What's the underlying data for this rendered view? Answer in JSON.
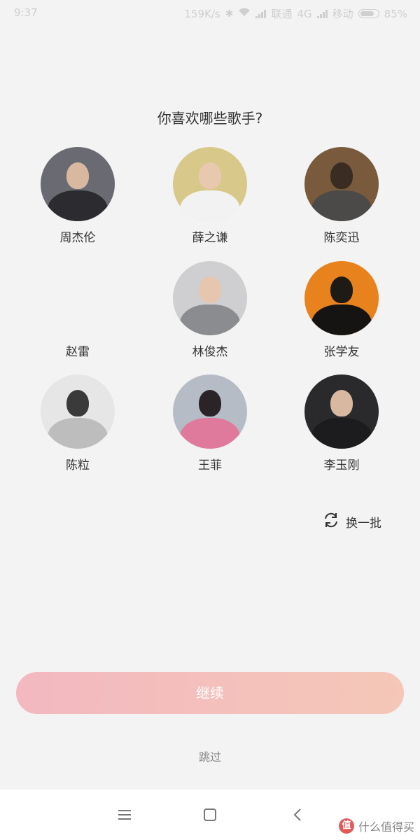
{
  "status_bar": {
    "time": "9:37",
    "speed": "159K/s",
    "carrier1": "联通",
    "net1": "4G",
    "carrier2": "移动",
    "battery": "85%"
  },
  "question": "你喜欢哪些歌手?",
  "singers": [
    {
      "name": "周杰伦",
      "colors": {
        "bg": "#6a6a72",
        "head": "#d9b8a0",
        "body": "#2c2c30"
      }
    },
    {
      "name": "薛之谦",
      "colors": {
        "bg": "#d8c88a",
        "head": "#e8c9b0",
        "body": "#f2f2f2"
      }
    },
    {
      "name": "陈奕迅",
      "colors": {
        "bg": "#7a5a3c",
        "head": "#3a2c22",
        "body": "#4c4a48"
      }
    },
    {
      "name": "赵雷",
      "colors": {
        "bg": "#f3f3f3",
        "head": "#f3f3f3",
        "body": "#f3f3f3"
      }
    },
    {
      "name": "林俊杰",
      "colors": {
        "bg": "#cfcfd1",
        "head": "#e6c6ae",
        "body": "#8a8c90"
      }
    },
    {
      "name": "张学友",
      "colors": {
        "bg": "#e8821c",
        "head": "#1e1a16",
        "body": "#161412"
      }
    },
    {
      "name": "陈粒",
      "colors": {
        "bg": "#e6e6e6",
        "head": "#3a3a3a",
        "body": "#bdbdbd"
      }
    },
    {
      "name": "王菲",
      "colors": {
        "bg": "#b6bcc6",
        "head": "#2a2428",
        "body": "#e07a9c"
      }
    },
    {
      "name": "李玉刚",
      "colors": {
        "bg": "#2a2a2c",
        "head": "#d8b8a0",
        "body": "#1c1c1e"
      }
    }
  ],
  "refresh_label": "换一批",
  "continue_label": "继续",
  "skip_label": "跳过",
  "watermark": "什么值得买"
}
